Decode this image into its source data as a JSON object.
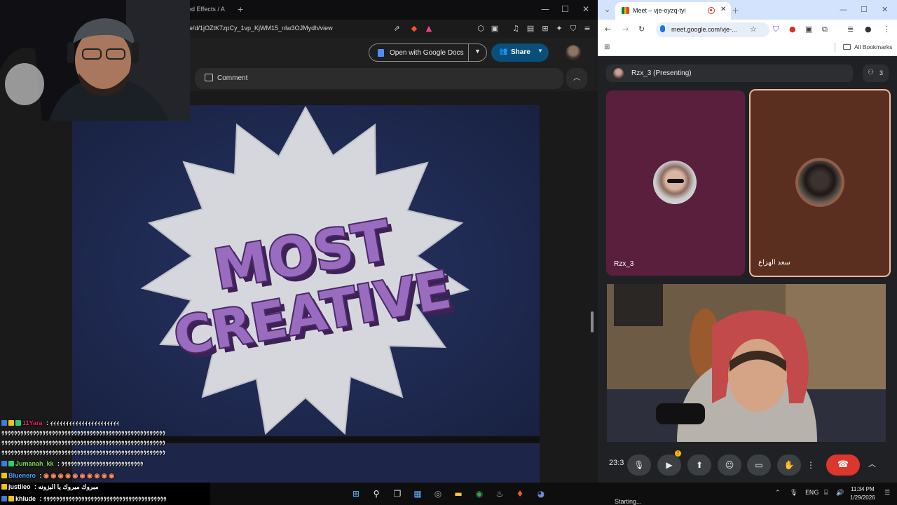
{
  "left_browser": {
    "tab_fragment": "nd Effects / A",
    "new_tab": "+",
    "url": "le/d/1jOZtK7zpCy_1vp_KjWM15_nlw3OJMydh/view",
    "open_with_label": "Open with Google Docs",
    "share_label": "Share",
    "comment_label": "Comment",
    "controls": {
      "minimize": "—",
      "maximize": "☐",
      "close": "✕"
    }
  },
  "document": {
    "badge_line1": "MOST",
    "badge_line2": "CREATIVE",
    "colors": {
      "background": "#1f2a52",
      "starburst": "#d6d7dd",
      "letters": "#9a6cc0",
      "letters_shadow": "#4a2a66"
    }
  },
  "right_browser": {
    "tab_title": "Meet – vje-oyzq-tyi",
    "url": "meet.google.com/vje-...",
    "bookmarks_label": "All Bookmarks",
    "presenting_label": "Rzx_3 (Presenting)",
    "participant_count": "3",
    "participants": [
      {
        "name": "Rzx_3",
        "tile_color": "#5a1f3d"
      },
      {
        "name": "سعد الهزاع",
        "tile_color": "#5b2f1f"
      }
    ],
    "meeting_time": "23:3",
    "end_call_color": "#dc362e"
  },
  "chat": [
    {
      "user": "11Yara",
      "user_color": "#e0245e",
      "separator": " :",
      "text": " ｨｨｨｨｨｨｨｨｨｨｨｨｨｨｨｨｨｨｨｨｨｨ"
    },
    {
      "user": "",
      "user_color": "#ffffff",
      "separator": "",
      "text": "ｩｩｩｩｩｩｩｩｩｩｩｩｩｩｩｩｩｩｩｩｩｩｩｩｩｩｩｩｩｩｩｩｩｩｩｩｩｩｩｩｩｩｩｩｩｩｩｩｩｩｩｩ"
    },
    {
      "user": "",
      "user_color": "#ffffff",
      "separator": "",
      "text": "ｩｩｩｩｩｩｩｩｩｩｩｩｩｩｩｩｩｩｩｩｩｩｩｩｩｩｩｩｩｩｩｩｩｩｩｩｩｩｩｩｩｩｩｩｩｩｩｩｩｩｩｩ"
    },
    {
      "user": "",
      "user_color": "#ffffff",
      "separator": "",
      "text": "ｩｩｩｩｩｩｩｩｩｩｩｩｩｩｩｩｩｩｩｩｩｩｩｩｩｩｩｩｩｩｩｩｩｩｩｩｩｩｩｩｩｩｩｩｩｩｩｩｩｩｩｩ"
    },
    {
      "user": "Jumanah_kk",
      "user_color": "#7ed957",
      "separator": " :",
      "text": " ｩｩｩｩｩｩｩｩｩｩｩｩｩｩｩｩｩｩｩｩｩｩｩｩｩｩ"
    },
    {
      "user": "Bluenero",
      "user_color": "#4aa3ff",
      "separator": " :",
      "text": " ◉ ◉ ◉ ◉ ◉ ◉ ◉ ◉ ◉ ◉"
    },
    {
      "user": "justlieo",
      "user_color": "#ffffff",
      "separator": " :",
      "text": " مبروك مبروك يا البزونه"
    },
    {
      "user": "khlude",
      "user_color": "#ffffff",
      "separator": " :",
      "text": " ｩｩｩｩｩｩｩｩｩｩｩｩｩｩｩｩｩｩｩｩｩｩｩｩｩｩｩｩｩｩｩｩｩｩｩｩｩｩｩ"
    }
  ],
  "taskbar": {
    "starting_label": "Starting...",
    "language": "ENG",
    "time": "11:34 PM",
    "date": "1/29/2026"
  }
}
